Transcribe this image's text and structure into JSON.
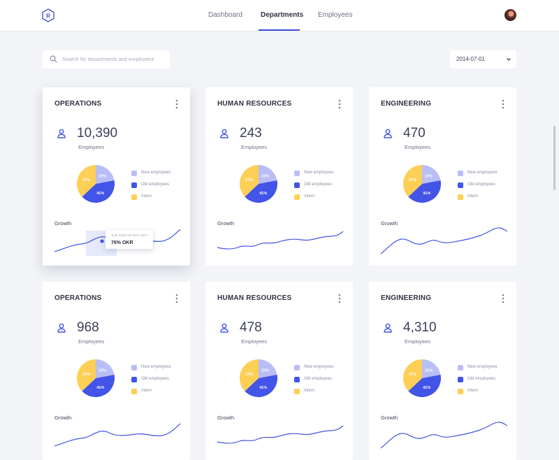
{
  "nav": {
    "items": [
      {
        "label": "Dashboard",
        "active": false
      },
      {
        "label": "Departments",
        "active": true
      },
      {
        "label": "Employees",
        "active": false
      }
    ]
  },
  "logo": {
    "letter": "R",
    "icon": "hexagon-logo-icon"
  },
  "search": {
    "placeholder": "Search for departments and employees"
  },
  "date_filter": {
    "value": "2014-07-01"
  },
  "colors": {
    "accent": "#3c4ad8",
    "new": "#b9bef5",
    "old": "#4354e8",
    "intern": "#fdcf55"
  },
  "legend": [
    "New employees",
    "Old employees",
    "Intern"
  ],
  "cards": [
    {
      "title": "OPERATIONS",
      "count": "10,390",
      "count_label": "Employees",
      "pie": [
        {
          "label": "22%",
          "value": 22
        },
        {
          "label": "41%",
          "value": 41
        },
        {
          "label": "37%",
          "value": 37
        }
      ],
      "growth_label": "Growth",
      "tooltip": {
        "range": "JUN 2016 TO MAY 2017",
        "value": "76% OKR"
      }
    },
    {
      "title": "HUMAN RESOURCES",
      "count": "243",
      "count_label": "Employees",
      "pie": [
        {
          "label": "22%",
          "value": 22
        },
        {
          "label": "41%",
          "value": 41
        },
        {
          "label": "37%",
          "value": 37
        }
      ],
      "growth_label": "Growth"
    },
    {
      "title": "ENGINEERING",
      "count": "470",
      "count_label": "Employees",
      "pie": [
        {
          "label": "22%",
          "value": 22
        },
        {
          "label": "41%",
          "value": 41
        },
        {
          "label": "37%",
          "value": 37
        }
      ],
      "growth_label": "Growth"
    },
    {
      "title": "OPERATIONS",
      "count": "968",
      "count_label": "Employees",
      "pie": [
        {
          "label": "22%",
          "value": 22
        },
        {
          "label": "41%",
          "value": 41
        },
        {
          "label": "37%",
          "value": 37
        }
      ],
      "growth_label": "Growth"
    },
    {
      "title": "HUMAN RESOURCES",
      "count": "478",
      "count_label": "Employees",
      "pie": [
        {
          "label": "22%",
          "value": 22
        },
        {
          "label": "41%",
          "value": 41
        },
        {
          "label": "37%",
          "value": 37
        }
      ],
      "growth_label": "Growth"
    },
    {
      "title": "ENGINEERING",
      "count": "4,310",
      "count_label": "Employees",
      "pie": [
        {
          "label": "22%",
          "value": 22
        },
        {
          "label": "41%",
          "value": 41
        },
        {
          "label": "37%",
          "value": 37
        }
      ],
      "growth_label": "Growth"
    }
  ]
}
